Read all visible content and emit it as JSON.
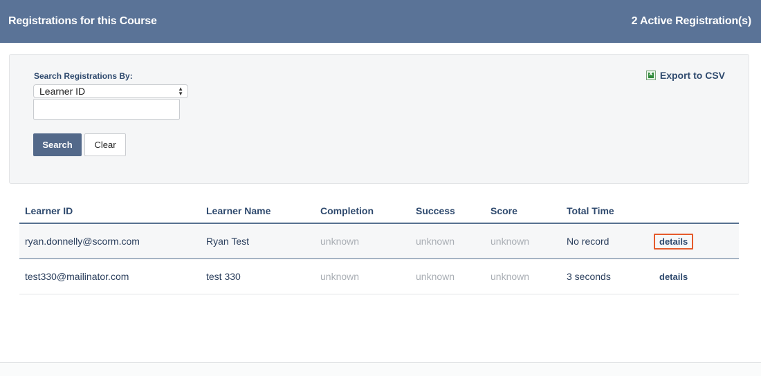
{
  "header": {
    "title": "Registrations for this Course",
    "active_count": "2 Active Registration(s)"
  },
  "search": {
    "label": "Search Registrations By:",
    "selected_option": "Learner ID",
    "input_value": "",
    "search_button": "Search",
    "clear_button": "Clear",
    "export_label": "Export to CSV"
  },
  "table": {
    "columns": [
      "Learner ID",
      "Learner Name",
      "Completion",
      "Success",
      "Score",
      "Total Time"
    ],
    "rows": [
      {
        "learner_id": "ryan.donnelly@scorm.com",
        "learner_name": "Ryan Test",
        "completion": "unknown",
        "success": "unknown",
        "score": "unknown",
        "total_time": "No record",
        "action": "details"
      },
      {
        "learner_id": "test330@mailinator.com",
        "learner_name": "test 330",
        "completion": "unknown",
        "success": "unknown",
        "score": "unknown",
        "total_time": "3 seconds",
        "action": "details"
      }
    ]
  },
  "colors": {
    "header_bg": "#5a7397",
    "primary_button": "#53698a",
    "highlight_border": "#e55a2b"
  }
}
